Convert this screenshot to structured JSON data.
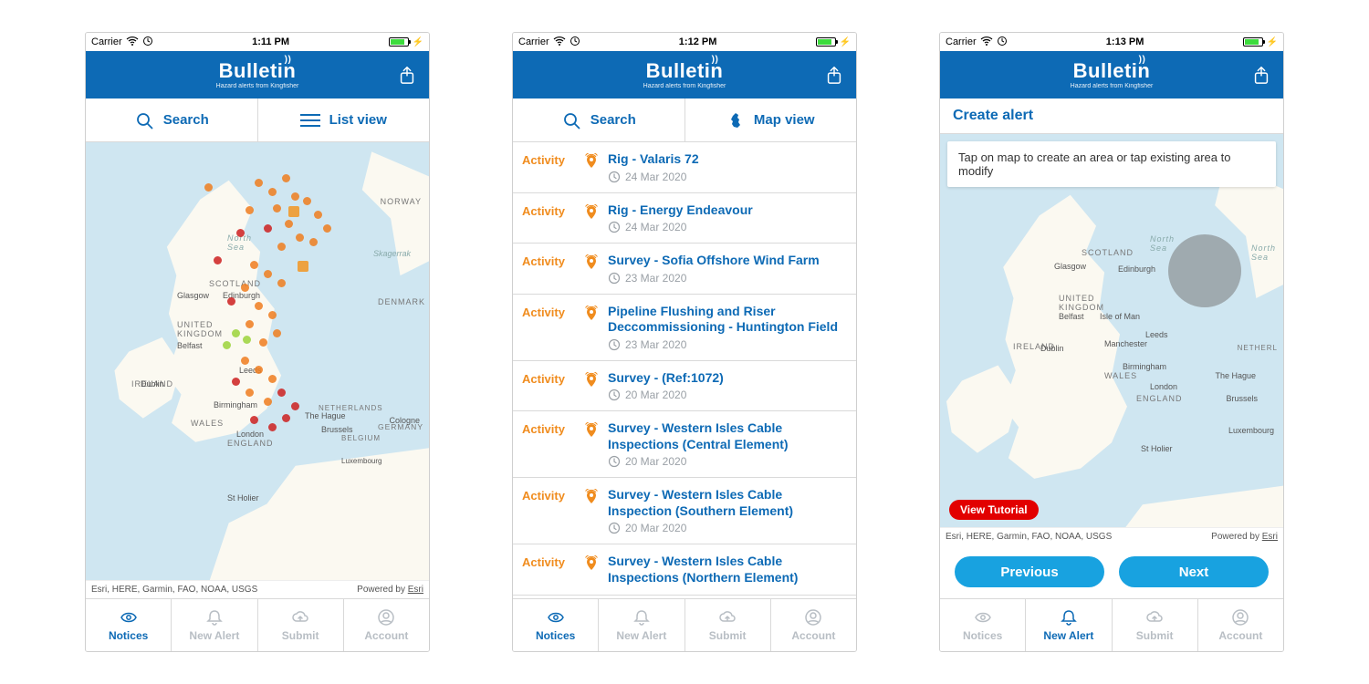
{
  "brand": {
    "name": "Bulletin",
    "tagline": "Hazard alerts from Kingfisher"
  },
  "status": {
    "carrier": "Carrier",
    "times": [
      "1:11 PM",
      "1:12 PM",
      "1:13 PM"
    ]
  },
  "toolbar": {
    "search": "Search",
    "list_view": "List view",
    "map_view": "Map view"
  },
  "map": {
    "attribution": "Esri, HERE, Garmin, FAO, NOAA, USGS",
    "powered_prefix": "Powered by ",
    "powered_link": "Esri",
    "labels": {
      "norway": "NORWAY",
      "denmark": "DENMARK",
      "germany": "GERMANY",
      "netherlands": "NETHERLANDS",
      "belgium": "BELGIUM",
      "luxembourg": "Luxembourg",
      "scotland": "SCOTLAND",
      "wales": "WALES",
      "england": "ENGLAND",
      "ireland": "IRELAND",
      "uk": "UNITED\nKINGDOM",
      "north_sea": "North\nSea",
      "netherl": "NETHERL",
      "the_hague": "The Hague"
    },
    "cities": {
      "glasgow": "Glasgow",
      "edinburgh": "Edinburgh",
      "belfast": "Belfast",
      "dublin": "Dublin",
      "leeds": "Leeds",
      "birmingham": "Birmingham",
      "london": "London",
      "brussels": "Brussels",
      "cologne": "Cologne",
      "skagerrak": "Skagerrak",
      "manchester": "Manchester",
      "stholier": "St Holier",
      "isle_of_man": "Isle of Man"
    }
  },
  "list": {
    "category_label": "Activity",
    "items": [
      {
        "title": "Rig - Valaris 72",
        "date": "24 Mar 2020"
      },
      {
        "title": "Rig - Energy Endeavour",
        "date": "24 Mar 2020"
      },
      {
        "title": "Survey - Sofia Offshore Wind Farm",
        "date": "23 Mar 2020"
      },
      {
        "title": "Pipeline Flushing and Riser Deccommissioning - Huntington Field",
        "date": "23 Mar 2020"
      },
      {
        "title": "Survey - (Ref:1072)",
        "date": "20 Mar 2020"
      },
      {
        "title": "Survey - Western Isles Cable Inspections (Central Element)",
        "date": "20 Mar 2020"
      },
      {
        "title": "Survey - Western Isles Cable Inspection (Southern Element)",
        "date": "20 Mar 2020"
      },
      {
        "title": "Survey - Western Isles Cable Inspections (Northern Element)",
        "date": ""
      }
    ]
  },
  "create_alert": {
    "heading": "Create alert",
    "tip": "Tap on map to create an area or tap existing area to modify",
    "tutorial_button": "View Tutorial",
    "previous": "Previous",
    "next": "Next"
  },
  "tabs": {
    "notices": "Notices",
    "new_alert": "New Alert",
    "submit": "Submit",
    "account": "Account"
  }
}
